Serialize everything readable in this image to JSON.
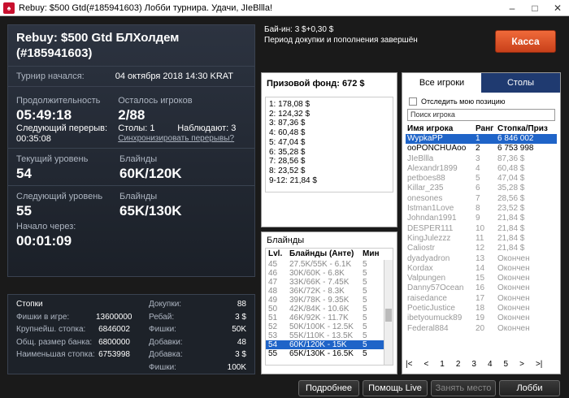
{
  "window": {
    "title": "Rebuy: $500 Gtd(#185941603) Лобби турнира. Удачи, JIeBllla!",
    "logo_letter": "♠",
    "minimize": "–",
    "maximize": "□",
    "close": "✕"
  },
  "tournament": {
    "name": "Rebuy: $500 Gtd БЛХолдем (#185941603)",
    "start_label": "Турнир начался:",
    "start_value": "04 октября 2018  14:30 KRAT",
    "duration_label": "Продолжительность",
    "duration_value": "05:49:18",
    "players_left_label": "Осталось игроков",
    "players_left_value": "2/88",
    "next_break_label": "Следующий перерыв:",
    "next_break_value": "00:35:08",
    "tables_label": "Столы: 1",
    "watching_label": "Наблюдают: 3",
    "sync_breaks_link": "Синхронизировать перерывы?",
    "current_level_label": "Текущий уровень",
    "current_level_value": "54",
    "blinds_label": "Блайнды",
    "current_blinds_value": "60K/120K",
    "next_level_label": "Следующий уровень",
    "next_level_value": "55",
    "next_blinds_label": "Блайнды",
    "next_blinds_value": "65K/130K",
    "start_in_label": "Начало через:",
    "start_in_value": "00:01:09"
  },
  "header_info": {
    "buyin": "Бай-ин: 3 $+0,30 $",
    "rebuy_status": "Период докупки и пополнения завершён",
    "cashier_button": "Касса"
  },
  "prize_pool": {
    "title": "Призовой фонд: 672 $",
    "places": [
      "1: 178,08 $",
      "2: 124,32 $",
      "3: 87,36 $",
      "4: 60,48 $",
      "5: 47,04 $",
      "6: 35,28 $",
      "7: 28,56 $",
      "8: 23,52 $",
      "9-12: 21,84 $"
    ]
  },
  "blinds": {
    "title": "Блайнды",
    "headers": [
      "Lvl.",
      "Блайнды (Анте)",
      "Мин"
    ],
    "rows": [
      [
        "45",
        "27.5K/55K - 6.1K",
        "5"
      ],
      [
        "46",
        "30K/60K - 6.8K",
        "5"
      ],
      [
        "47",
        "33K/66K - 7.45K",
        "5"
      ],
      [
        "48",
        "36K/72K - 8.3K",
        "5"
      ],
      [
        "49",
        "39K/78K - 9.35K",
        "5"
      ],
      [
        "50",
        "42K/84K - 10.6K",
        "5"
      ],
      [
        "51",
        "46K/92K - 11.7K",
        "5"
      ],
      [
        "52",
        "50K/100K - 12.5K",
        "5"
      ],
      [
        "53",
        "55K/110K - 13.5K",
        "5"
      ],
      [
        "54",
        "60K/120K - 15K",
        "5"
      ],
      [
        "55",
        "65K/130K - 16.5K",
        "5"
      ]
    ],
    "current_index": 9
  },
  "players": {
    "tab_all": "Все игроки",
    "tab_tables": "Столы",
    "track_label": "Отследить мою позицию",
    "search_value": "Поиск игрока",
    "headers": [
      "Имя игрока",
      "Ранг",
      "Стопка/Приз"
    ],
    "rows": [
      [
        "WypkaPP",
        "1",
        "6 846 002"
      ],
      [
        "ooPONCHUAoo",
        "2",
        "6 753 998"
      ],
      [
        "JIeBllla",
        "3",
        "87,36 $"
      ],
      [
        "Alexandr1899",
        "4",
        "60,48 $"
      ],
      [
        "petboes88",
        "5",
        "47,04 $"
      ],
      [
        "Killar_235",
        "6",
        "35,28 $"
      ],
      [
        "onesones",
        "7",
        "28,56 $"
      ],
      [
        "Istman1Love",
        "8",
        "23,52 $"
      ],
      [
        "Johndan1991",
        "9",
        "21,84 $"
      ],
      [
        "DESPER111",
        "10",
        "21,84 $"
      ],
      [
        "KingJulezzz",
        "11",
        "21,84 $"
      ],
      [
        "Caliostr",
        "12",
        "21,84 $"
      ],
      [
        "dyadyadron",
        "13",
        "Окончен"
      ],
      [
        "Kordax",
        "14",
        "Окончен"
      ],
      [
        "Valpungen",
        "15",
        "Окончен"
      ],
      [
        "Danny57Ocean",
        "16",
        "Окончен"
      ],
      [
        "raisedance",
        "17",
        "Окончен"
      ],
      [
        "PoeticJustice",
        "18",
        "Окончен"
      ],
      [
        "ibetyoumuck89",
        "19",
        "Окончен"
      ],
      [
        "Federal884",
        "20",
        "Окончен"
      ]
    ],
    "pager": [
      "|<",
      "<",
      "1",
      "2",
      "3",
      "4",
      "5",
      ">",
      ">|"
    ]
  },
  "stacks": {
    "title": "Стопки",
    "left": [
      [
        "Фишки в игре:",
        "13600000"
      ],
      [
        "Крупнейш. стопка:",
        "6846002"
      ],
      [
        "Общ. размер банка:",
        "6800000"
      ],
      [
        "Наименьшая стопка:",
        "6753998"
      ]
    ],
    "right": [
      [
        "Докупки:",
        "88"
      ],
      [
        "Ребай:",
        "3 $"
      ],
      [
        "Фишки:",
        "50K"
      ],
      [
        "Добавки:",
        "48"
      ],
      [
        "Добавка:",
        "3 $"
      ],
      [
        "Фишки:",
        "100K"
      ]
    ]
  },
  "bottom": {
    "details": "Подробнее",
    "help_live": "Помощь Live",
    "take_seat": "Занять место",
    "lobby": "Лобби"
  }
}
